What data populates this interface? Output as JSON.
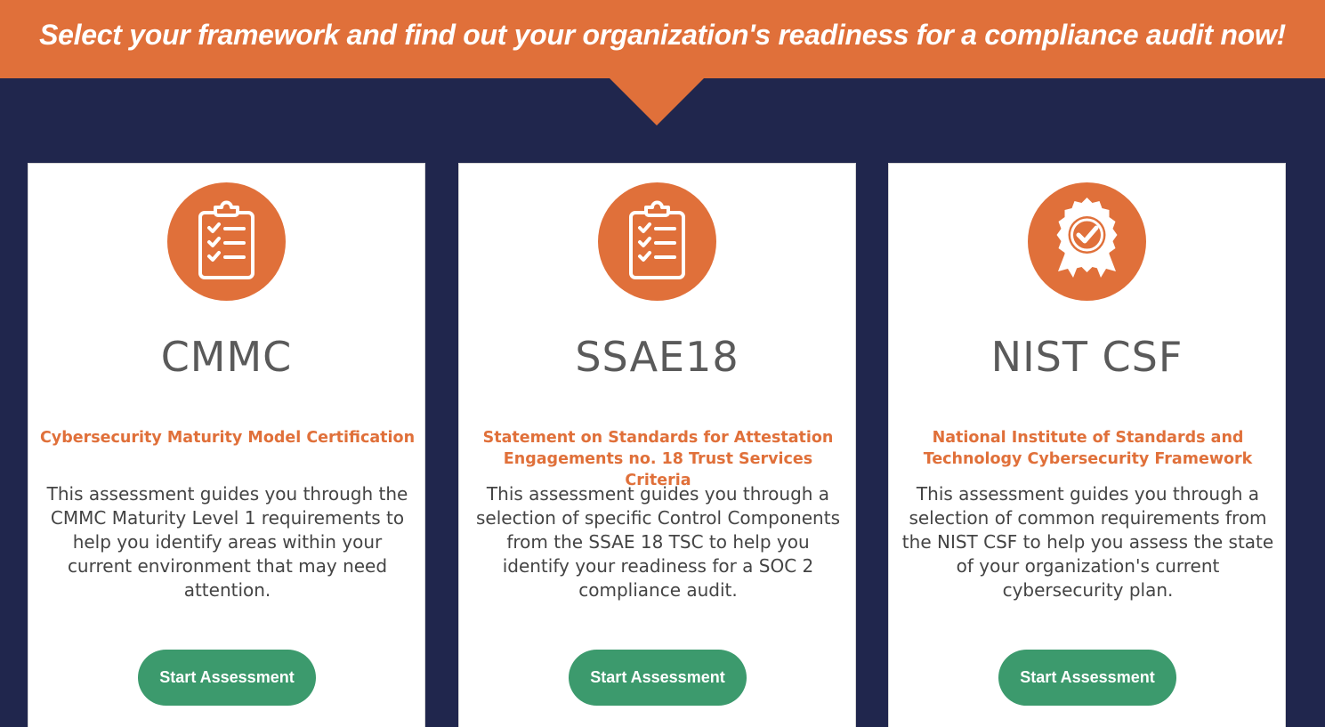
{
  "banner": {
    "headline": "Select your framework and find out your organization's readiness for a compliance audit now!"
  },
  "colors": {
    "accent": "#e0703a",
    "background": "#20264d",
    "button": "#3c9a6d",
    "card": "#ffffff"
  },
  "cards": [
    {
      "icon": "clipboard-checklist-icon",
      "title": "CMMC",
      "subtitle": "Cybersecurity Maturity Model Certification",
      "description": "This assessment guides you through the CMMC Maturity Level 1 requirements to help you identify areas within your current environment that may need attention.",
      "button_label": "Start Assessment"
    },
    {
      "icon": "clipboard-checklist-icon",
      "title": "SSAE18",
      "subtitle": "Statement on Standards for Attestation Engagements no. 18 Trust Services Criteria",
      "description": "This assessment guides you through a selection of specific Control Components from the SSAE 18 TSC to help you identify your readiness for a SOC 2 compliance audit.",
      "button_label": "Start Assessment"
    },
    {
      "icon": "award-badge-icon",
      "title": "NIST CSF",
      "subtitle": "National Institute of Standards and Technology Cybersecurity Framework",
      "description": "This assessment guides you through a selection of common requirements from the NIST CSF to help you assess the state of your organization's current cybersecurity plan.",
      "button_label": "Start Assessment"
    }
  ]
}
